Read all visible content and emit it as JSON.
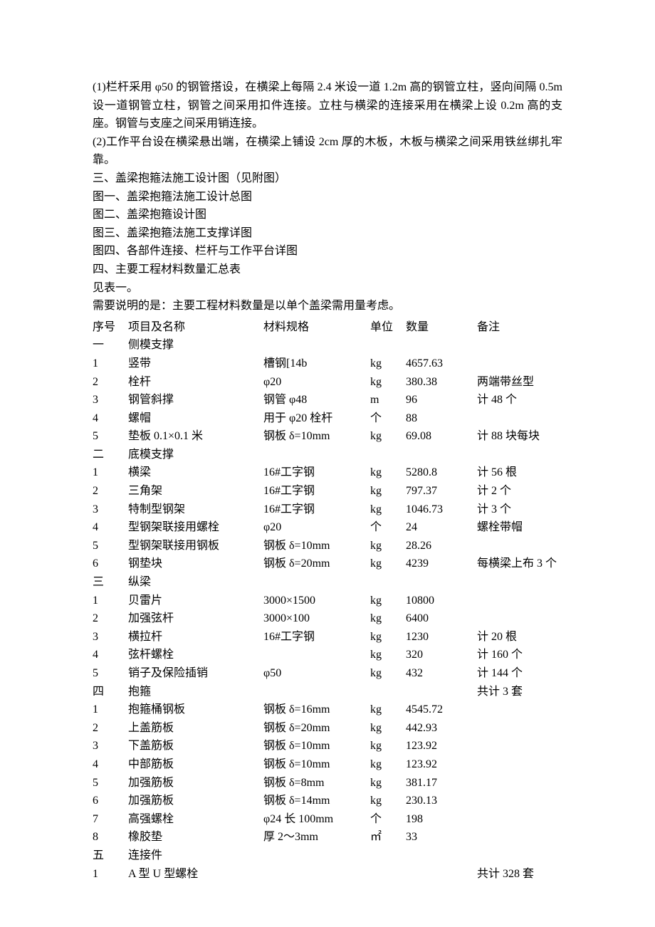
{
  "paragraphs": {
    "p1": "(1)栏杆采用 φ50 的钢管搭设，在横梁上每隔 2.4 米设一道 1.2m 高的钢管立柱，竖向间隔 0.5m 设一道钢管立柱，钢管之间采用扣件连接。立柱与横梁的连接采用在横梁上设 0.2m 高的支座。钢管与支座之间采用销连接。",
    "p2": "(2)工作平台设在横梁悬出端，在横梁上铺设 2cm 厚的木板，木板与横梁之间采用铁丝绑扎牢靠。",
    "p3": "三、盖梁抱箍法施工设计图（见附图）",
    "p4": "图一、盖梁抱箍法施工设计总图",
    "p5": "图二、盖梁抱箍设计图",
    "p6": "图三、盖梁抱箍法施工支撑详图",
    "p7": "图四、各部件连接、栏杆与工作平台详图",
    "p8": "四、主要工程材料数量汇总表",
    "p9": "见表一。",
    "p10": "需要说明的是：主要工程材料数量是以单个盖梁需用量考虑。"
  },
  "headers": {
    "idx": "序号",
    "name": "项目及名称",
    "spec": "材料规格",
    "unit": "单位",
    "qty": "数量",
    "note": "备注"
  },
  "rows": [
    {
      "idx": "一",
      "name": "侧模支撑",
      "spec": "",
      "unit": "",
      "qty": "",
      "note": ""
    },
    {
      "idx": "1",
      "name": "竖带",
      "spec": "槽钢[14b",
      "unit": "kg",
      "qty": "4657.63",
      "note": ""
    },
    {
      "idx": "2",
      "name": "栓杆",
      "spec": "φ20",
      "unit": "kg",
      "qty": "380.38",
      "note": "两端带丝型"
    },
    {
      "idx": "3",
      "name": "钢管斜撑",
      "spec": "钢管 φ48",
      "unit": "m",
      "qty": "96",
      "note": "计 48 个"
    },
    {
      "idx": "4",
      "name": "螺帽",
      "spec": "用于 φ20 栓杆",
      "unit": "个",
      "qty": "88",
      "note": ""
    },
    {
      "idx": "5",
      "name": "垫板 0.1×0.1 米",
      "spec": "钢板 δ=10mm",
      "unit": "kg",
      "qty": "69.08",
      "note": "计 88 块每块"
    },
    {
      "idx": "二",
      "name": "底模支撑",
      "spec": "",
      "unit": "",
      "qty": "",
      "note": ""
    },
    {
      "idx": "1",
      "name": "横梁",
      "spec": "16#工字钢",
      "unit": "kg",
      "qty": "5280.8",
      "note": "计 56 根"
    },
    {
      "idx": "2",
      "name": "三角架",
      "spec": "16#工字钢",
      "unit": "kg",
      "qty": "797.37",
      "note": "计 2 个"
    },
    {
      "idx": "3",
      "name": "特制型钢架",
      "spec": "16#工字钢",
      "unit": "kg",
      "qty": "1046.73",
      "note": "计 3 个"
    },
    {
      "idx": "4",
      "name": "型钢架联接用螺栓",
      "spec": "φ20",
      "unit": "个",
      "qty": "24",
      "note": "螺栓带帽"
    },
    {
      "idx": "5",
      "name": "型钢架联接用钢板",
      "spec": "钢板 δ=10mm",
      "unit": "kg",
      "qty": "28.26",
      "note": ""
    },
    {
      "idx": "6",
      "name": "钢垫块",
      "spec": "钢板 δ=20mm",
      "unit": "kg",
      "qty": "4239",
      "note": "每横梁上布 3 个"
    },
    {
      "idx": "三",
      "name": "纵梁",
      "spec": "",
      "unit": "",
      "qty": "",
      "note": ""
    },
    {
      "idx": "1",
      "name": "贝雷片",
      "spec": "3000×1500",
      "unit": "kg",
      "qty": "10800",
      "note": ""
    },
    {
      "idx": "2",
      "name": "加强弦杆",
      "spec": "3000×100",
      "unit": "kg",
      "qty": "6400",
      "note": ""
    },
    {
      "idx": "3",
      "name": "横拉杆",
      "spec": "16#工字钢",
      "unit": "kg",
      "qty": "1230",
      "note": "计 20 根"
    },
    {
      "idx": "4",
      "name": "弦杆螺栓",
      "spec": "",
      "unit": "kg",
      "qty": "320",
      "note": "计 160 个"
    },
    {
      "idx": "5",
      "name": "销子及保险插销",
      "spec": "φ50",
      "unit": "kg",
      "qty": "432",
      "note": "计 144 个"
    },
    {
      "idx": "四",
      "name": "抱箍",
      "spec": "",
      "unit": "",
      "qty": "",
      "note": "共计 3 套"
    },
    {
      "idx": "1",
      "name": "抱箍桶钢板",
      "spec": "钢板 δ=16mm",
      "unit": "kg",
      "qty": "4545.72",
      "note": ""
    },
    {
      "idx": "2",
      "name": "上盖筋板",
      "spec": "钢板 δ=20mm",
      "unit": "kg",
      "qty": "442.93",
      "note": ""
    },
    {
      "idx": "3",
      "name": "下盖筋板",
      "spec": "钢板 δ=10mm",
      "unit": "kg",
      "qty": "123.92",
      "note": ""
    },
    {
      "idx": "4",
      "name": "中部筋板",
      "spec": "钢板 δ=10mm",
      "unit": "kg",
      "qty": "123.92",
      "note": ""
    },
    {
      "idx": "5",
      "name": "加强筋板",
      "spec": "钢板 δ=8mm",
      "unit": "kg",
      "qty": "381.17",
      "note": ""
    },
    {
      "idx": "6",
      "name": "加强筋板",
      "spec": "钢板 δ=14mm",
      "unit": "kg",
      "qty": "230.13",
      "note": ""
    },
    {
      "idx": "7",
      "name": "高强螺栓",
      "spec": "φ24 长 100mm",
      "unit": "个",
      "qty": "198",
      "note": ""
    },
    {
      "idx": "8",
      "name": "橡胶垫",
      "spec": "厚 2～3mm",
      "unit": "㎡",
      "qty": "33",
      "note": ""
    },
    {
      "idx": "五",
      "name": "连接件",
      "spec": "",
      "unit": "",
      "qty": "",
      "note": ""
    },
    {
      "idx": "1",
      "name": "A 型 U 型螺栓",
      "spec": "",
      "unit": "",
      "qty": "",
      "note": "共计 328 套"
    }
  ]
}
